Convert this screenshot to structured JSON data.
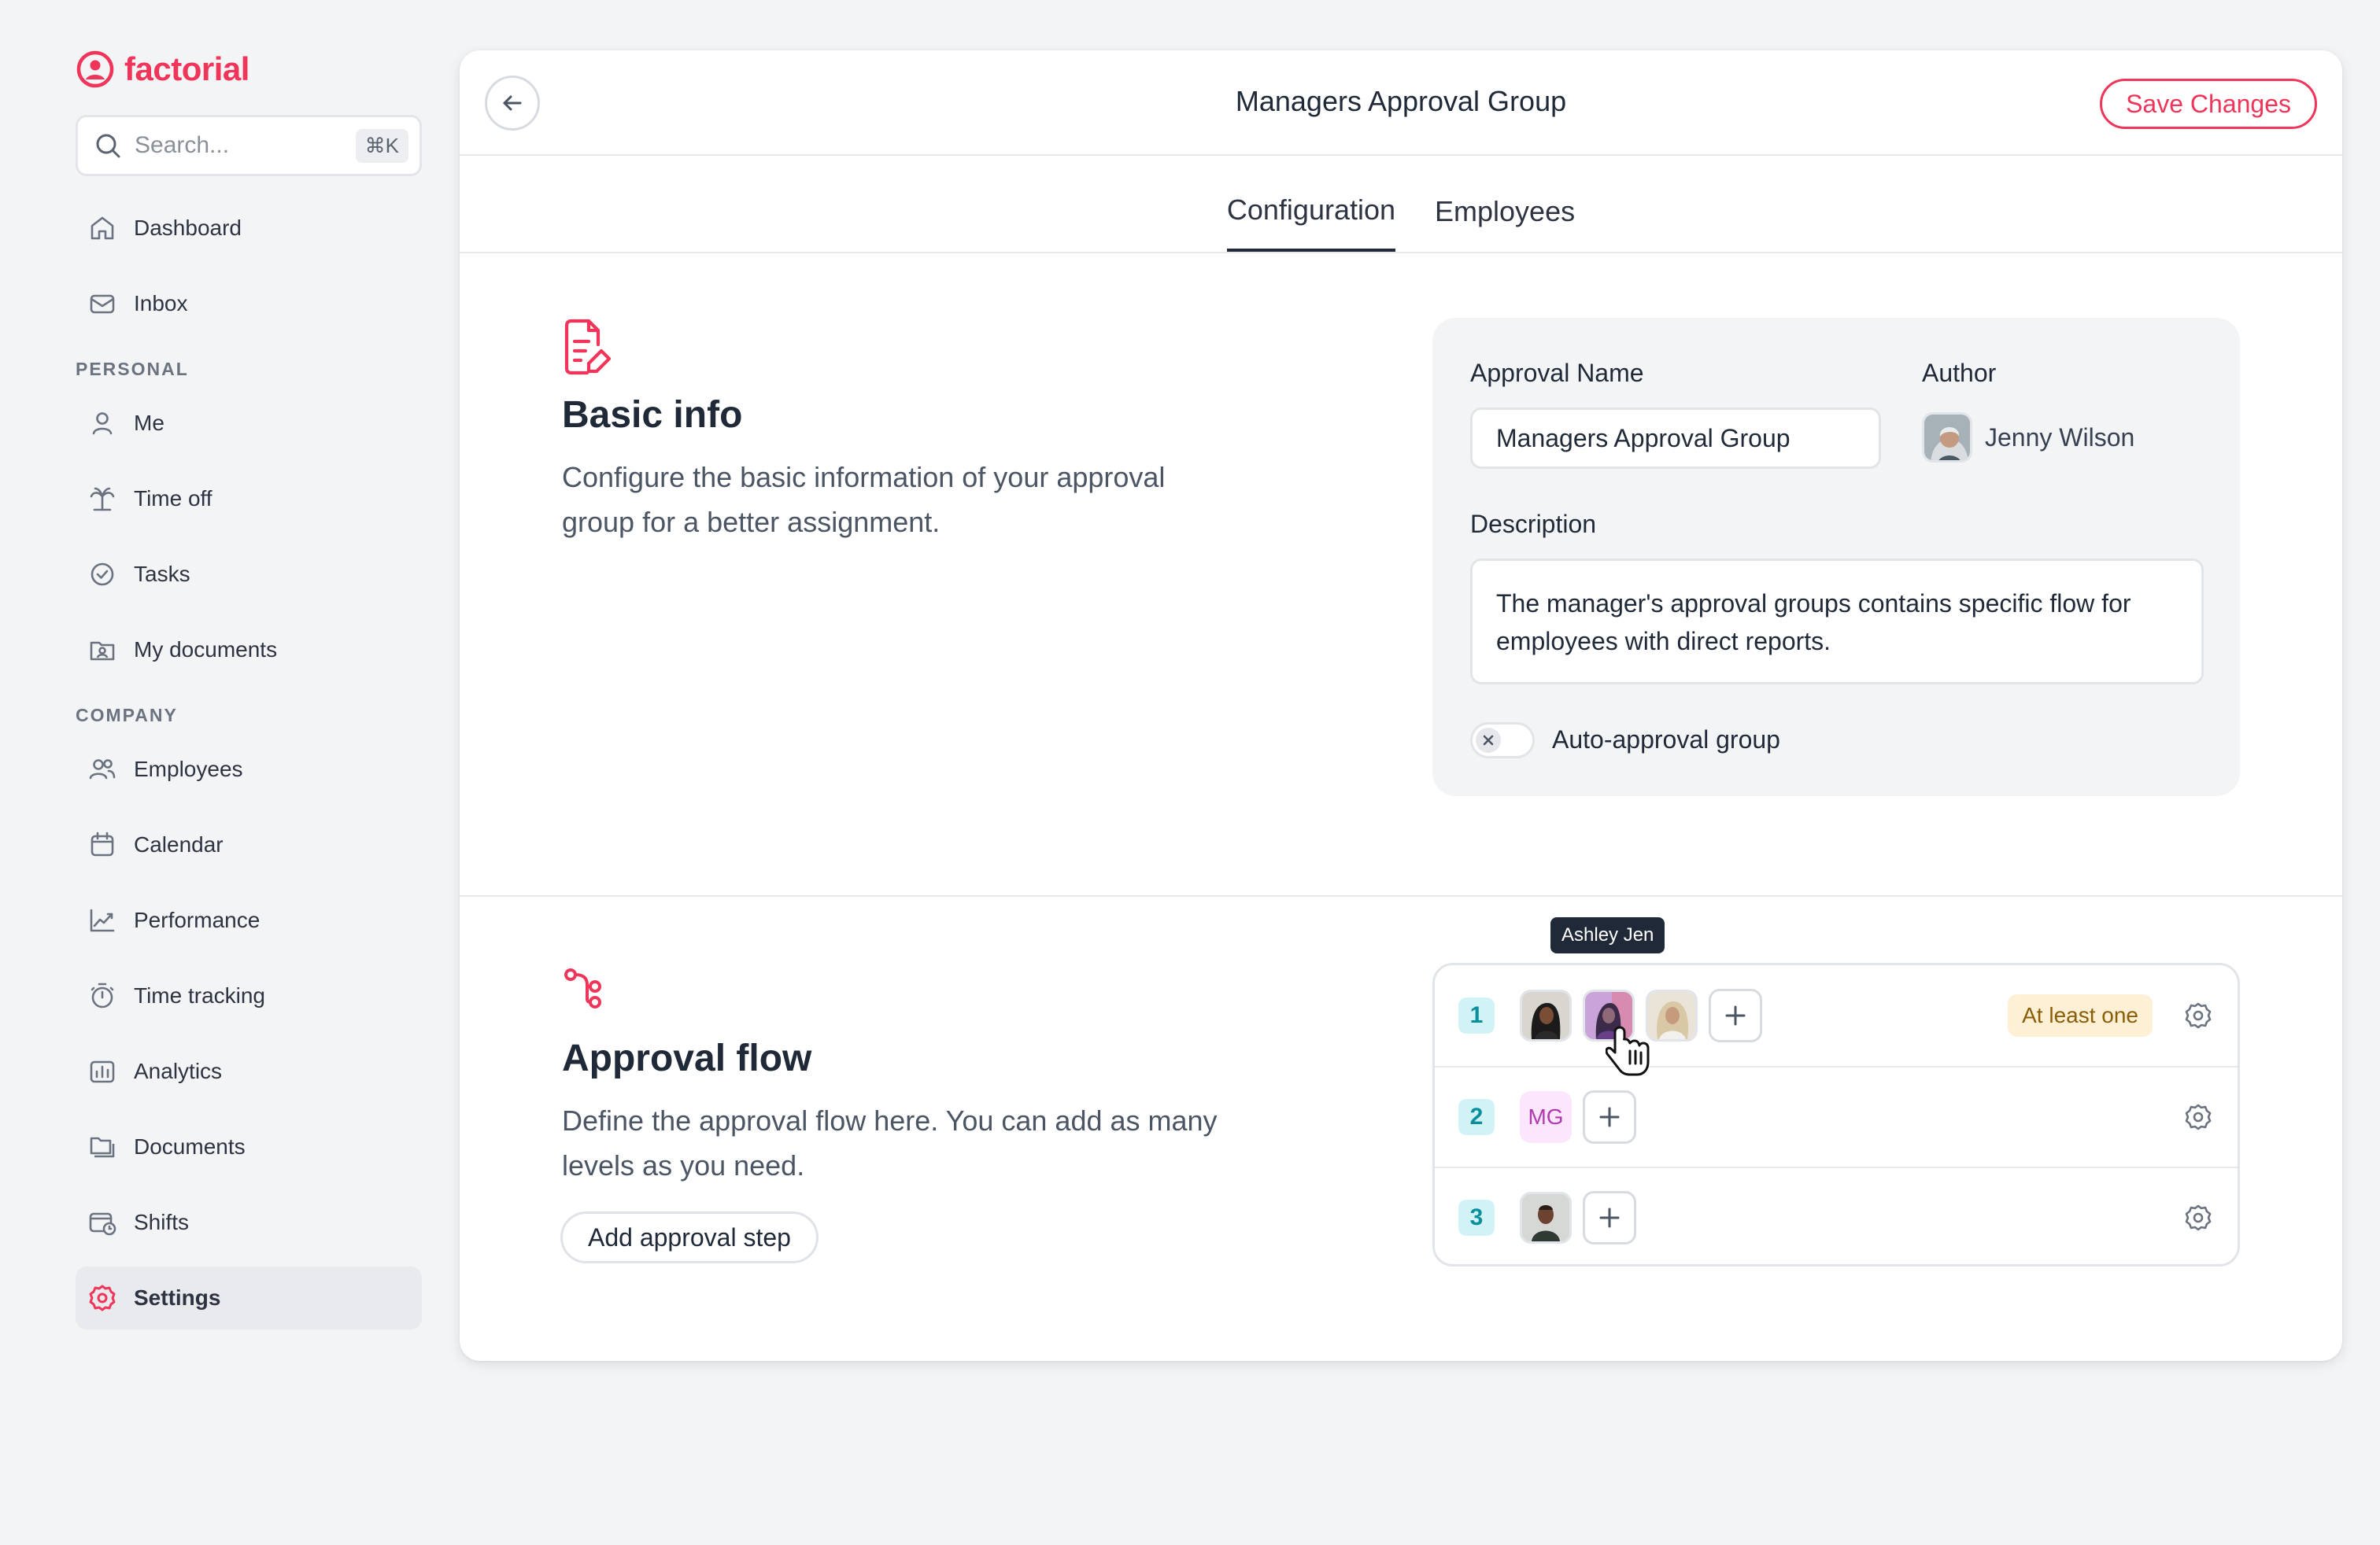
{
  "brand": {
    "name": "factorial",
    "color": "#f0355a"
  },
  "search": {
    "placeholder": "Search...",
    "shortcut": "⌘K"
  },
  "sidebar": {
    "top_items": [
      {
        "label": "Dashboard",
        "icon": "home-icon"
      },
      {
        "label": "Inbox",
        "icon": "inbox-icon"
      }
    ],
    "personal_label": "PERSONAL",
    "personal_items": [
      {
        "label": "Me",
        "icon": "user-icon"
      },
      {
        "label": "Time off",
        "icon": "palm-tree-icon"
      },
      {
        "label": "Tasks",
        "icon": "check-circle-icon"
      },
      {
        "label": "My documents",
        "icon": "folder-user-icon"
      }
    ],
    "company_label": "COMPANY",
    "company_items": [
      {
        "label": "Employees",
        "icon": "users-icon"
      },
      {
        "label": "Calendar",
        "icon": "calendar-icon"
      },
      {
        "label": "Performance",
        "icon": "chart-line-icon"
      },
      {
        "label": "Time tracking",
        "icon": "stopwatch-icon"
      },
      {
        "label": "Analytics",
        "icon": "bar-chart-icon"
      },
      {
        "label": "Documents",
        "icon": "folders-icon"
      },
      {
        "label": "Shifts",
        "icon": "shifts-icon"
      },
      {
        "label": "Settings",
        "icon": "settings-icon",
        "active": true
      }
    ]
  },
  "header": {
    "title": "Managers Approval Group",
    "save_label": "Save Changes"
  },
  "tabs": [
    {
      "label": "Configuration",
      "active": true
    },
    {
      "label": "Employees",
      "active": false
    }
  ],
  "basic_info": {
    "title": "Basic info",
    "description": "Configure the basic information of your approval group for a better assignment.",
    "approval_name_label": "Approval Name",
    "approval_name_value": "Managers Approval Group",
    "author_label": "Author",
    "author_name": "Jenny Wilson",
    "description_label": "Description",
    "description_value": "The manager's approval groups contains specific flow for employees with direct reports.",
    "auto_approval_label": "Auto-approval group",
    "auto_approval_enabled": false
  },
  "approval_flow": {
    "title": "Approval flow",
    "description": "Define the approval flow here. You can add as many levels as you need.",
    "add_step_label": "Add approval step",
    "tooltip": "Ashley Jen",
    "steps": [
      {
        "number": "1",
        "badge": "At least one"
      },
      {
        "number": "2",
        "initials": "MG"
      },
      {
        "number": "3"
      }
    ]
  }
}
